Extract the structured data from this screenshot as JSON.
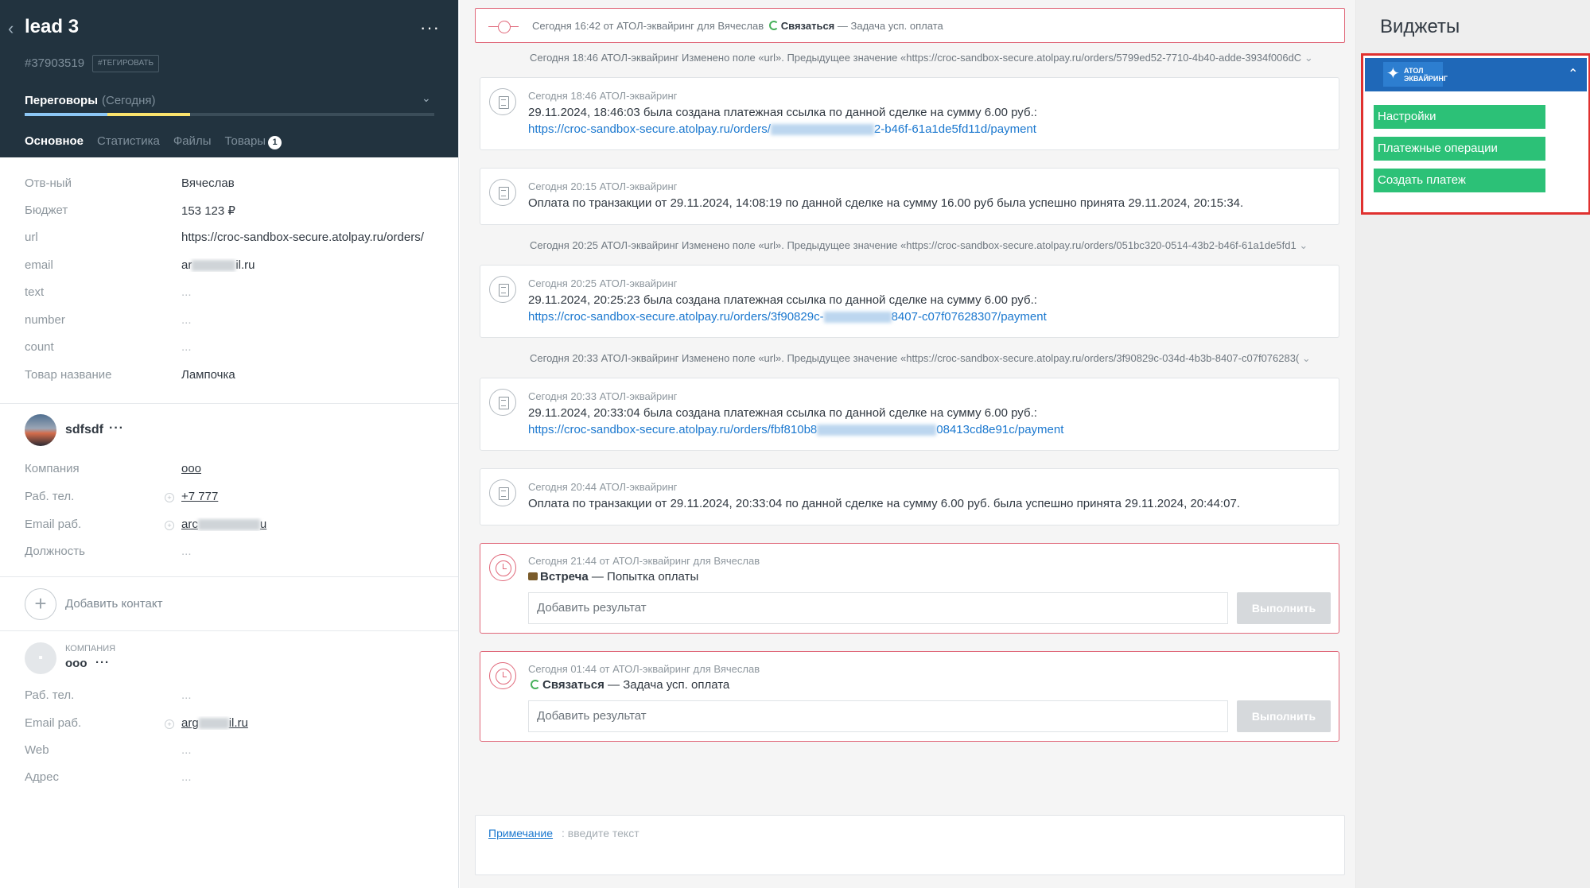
{
  "lead": {
    "title": "lead 3",
    "more": "···",
    "id": "#37903519",
    "tag_button": "#ТЕГИРОВАТЬ",
    "stage": "Переговоры",
    "stage_date": "(Сегодня)",
    "tabs": [
      {
        "label": "Основное"
      },
      {
        "label": "Статистика"
      },
      {
        "label": "Файлы"
      },
      {
        "label": "Товары"
      }
    ],
    "tab_badge": "1"
  },
  "fields": [
    {
      "label": "Отв-ный",
      "value": "Вячеслав"
    },
    {
      "label": "Бюджет",
      "value": "153 123 ₽"
    },
    {
      "label": "url",
      "value": "https://croc-sandbox-secure.atolpay.ru/orders/"
    },
    {
      "label": "email",
      "value_pre": "ar",
      "value_post": "il.ru"
    },
    {
      "label": "text",
      "value": "..."
    },
    {
      "label": "number",
      "value": "..."
    },
    {
      "label": "count",
      "value": "..."
    },
    {
      "label": "Товар название",
      "value": "Лампочка"
    }
  ],
  "contact": {
    "name": "sdfsdf",
    "more": "···",
    "fields": [
      {
        "label": "Компания",
        "value": "ооо"
      },
      {
        "label": "Раб. тел.",
        "value": "+7 777"
      },
      {
        "label": "Email раб.",
        "value_pre": "arc",
        "value_post": "u"
      },
      {
        "label": "Должность",
        "value": "..."
      }
    ],
    "add_contact": "Добавить контакт"
  },
  "company": {
    "caption": "КОМПАНИЯ",
    "name": "ооо",
    "more": "···",
    "fields": [
      {
        "label": "Раб. тел.",
        "value": "..."
      },
      {
        "label": "Email раб.",
        "value_pre": "arg",
        "value_post": "il.ru"
      },
      {
        "label": "Web",
        "value": "..."
      },
      {
        "label": "Адрес",
        "value": "..."
      }
    ]
  },
  "feed": {
    "top_task": {
      "meta": "Сегодня 16:42 от АТОЛ-эквайринг для Вячеслав",
      "type": "Связаться",
      "text": "— Задача усп. оплата"
    },
    "sys1": "Сегодня 18:46 АТОЛ-эквайринг Изменено поле «url». Предыдущее значение «https://croc-sandbox-secure.atolpay.ru/orders/5799ed52-7710-4b40-adde-3934f006dC",
    "card1": {
      "meta": "Сегодня 18:46 АТОЛ-эквайринг",
      "body": "29.11.2024, 18:46:03 была создана платежная ссылка по данной сделке на сумму 6.00 руб.:",
      "link_pre": "https://croc-sandbox-secure.atolpay.ru/orders/",
      "link_post": "2-b46f-61a1de5fd11d/payment"
    },
    "card2": {
      "meta": "Сегодня 20:15 АТОЛ-эквайринг",
      "body": "Оплата по транзакции от 29.11.2024, 14:08:19 по данной сделке на сумму 16.00 руб была успешно принята 29.11.2024, 20:15:34."
    },
    "sys2": "Сегодня 20:25 АТОЛ-эквайринг Изменено поле «url». Предыдущее значение «https://croc-sandbox-secure.atolpay.ru/orders/051bc320-0514-43b2-b46f-61a1de5fd1",
    "card3": {
      "meta": "Сегодня 20:25 АТОЛ-эквайринг",
      "body": "29.11.2024, 20:25:23 была создана платежная ссылка по данной сделке на сумму 6.00 руб.:",
      "link_pre": "https://croc-sandbox-secure.atolpay.ru/orders/3f90829c-",
      "link_post": "8407-c07f07628307/payment"
    },
    "sys3": "Сегодня 20:33 АТОЛ-эквайринг Изменено поле «url». Предыдущее значение «https://croc-sandbox-secure.atolpay.ru/orders/3f90829c-034d-4b3b-8407-c07f076283(",
    "card4": {
      "meta": "Сегодня 20:33 АТОЛ-эквайринг",
      "body": "29.11.2024, 20:33:04 была создана платежная ссылка по данной сделке на сумму 6.00 руб.:",
      "link_pre": "https://croc-sandbox-secure.atolpay.ru/orders/fbf810b8",
      "link_post": "08413cd8e91c/payment"
    },
    "card5": {
      "meta": "Сегодня 20:44 АТОЛ-эквайринг",
      "body": "Оплата по транзакции от 29.11.2024, 20:33:04 по данной сделке на сумму 6.00 руб. была успешно принята 29.11.2024, 20:44:07."
    },
    "task1": {
      "meta": "Сегодня 21:44 от АТОЛ-эквайринг для Вячеслав",
      "type": "Встреча",
      "text": "— Попытка оплаты",
      "placeholder": "Добавить результат",
      "button": "Выполнить"
    },
    "task2": {
      "meta": "Сегодня 01:44 от АТОЛ-эквайринг для Вячеслав",
      "type": "Связаться",
      "text": "— Задача усп. оплата",
      "placeholder": "Добавить результат",
      "button": "Выполнить"
    },
    "note": {
      "link": "Примечание",
      "placeholder": ": введите текст"
    }
  },
  "widgets": {
    "title": "Виджеты",
    "logo_line1": "АТОЛ",
    "logo_line2": "ЭКВАЙРИНГ",
    "buttons": [
      "Настройки",
      "Платежные операции",
      "Создать платеж"
    ]
  }
}
